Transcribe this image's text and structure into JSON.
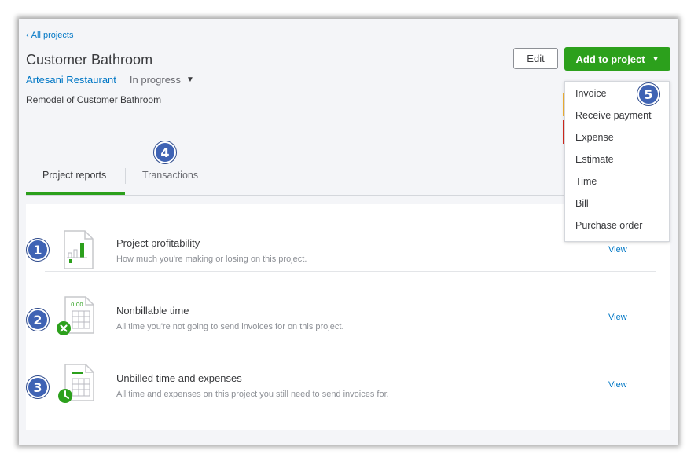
{
  "nav": {
    "back_label": "All projects"
  },
  "project": {
    "title": "Customer Bathroom",
    "customer": "Artesani Restaurant",
    "status": "In progress",
    "description": "Remodel of Customer Bathroom"
  },
  "actions": {
    "edit_label": "Edit",
    "add_label": "Add to project",
    "menu": [
      "Invoice",
      "Receive payment",
      "Expense",
      "Estimate",
      "Time",
      "Bill",
      "Purchase order"
    ]
  },
  "tabs": [
    {
      "label": "Project reports",
      "active": true
    },
    {
      "label": "Transactions",
      "active": false
    }
  ],
  "reports": [
    {
      "title": "Project profitability",
      "subtitle": "How much you're making or losing on this project.",
      "view": "View"
    },
    {
      "title": "Nonbillable time",
      "subtitle": "All time you're not going to send invoices for on this project.",
      "view": "View",
      "clock_label": "0:00"
    },
    {
      "title": "Unbilled time and expenses",
      "subtitle": "All time and expenses on this project you still need to send invoices for.",
      "view": "View"
    }
  ],
  "badges": [
    "1",
    "2",
    "3",
    "4",
    "5"
  ],
  "colors": {
    "accent_green": "#2ca01c",
    "link_blue": "#0077c5",
    "badge_blue": "#3f63b4"
  }
}
